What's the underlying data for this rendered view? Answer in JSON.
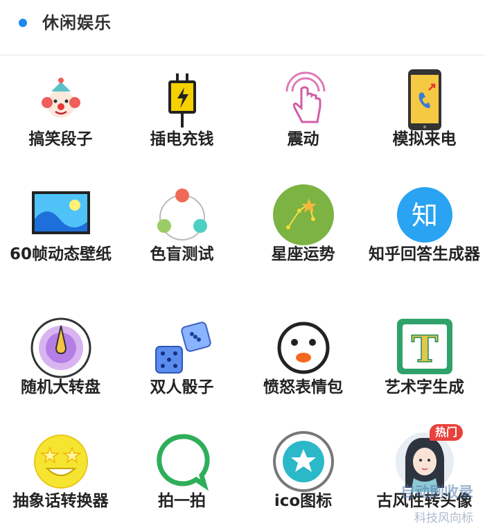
{
  "section": {
    "title": "休闲娱乐"
  },
  "tiles": [
    {
      "label": "搞笑段子",
      "icon": "clown-icon"
    },
    {
      "label": "插电充钱",
      "icon": "plug-icon"
    },
    {
      "label": "震动",
      "icon": "finger-tap-icon"
    },
    {
      "label": "模拟来电",
      "icon": "phone-call-icon"
    },
    {
      "label": "60帧动态壁纸",
      "icon": "wallpaper-icon"
    },
    {
      "label": "色盲测试",
      "icon": "color-test-icon"
    },
    {
      "label": "星座运势",
      "icon": "constellation-icon"
    },
    {
      "label": "知乎回答生成器",
      "icon": "zhihu-icon",
      "icon_text": "知"
    },
    {
      "label": "随机大转盘",
      "icon": "spinner-wheel-icon"
    },
    {
      "label": "双人骰子",
      "icon": "dice-icon"
    },
    {
      "label": "愤怒表情包",
      "icon": "angry-face-icon"
    },
    {
      "label": "艺术字生成",
      "icon": "art-text-icon",
      "icon_text": "T"
    },
    {
      "label": "抽象话转换器",
      "icon": "star-eyes-emoji-icon"
    },
    {
      "label": "拍一拍",
      "icon": "chat-bubble-icon"
    },
    {
      "label": "ico图标",
      "icon": "star-badge-icon"
    },
    {
      "label": "古风性转头像",
      "icon": "avatar-icon",
      "badge": "热门"
    }
  ],
  "watermark": {
    "line1": "自动刷收录",
    "line2": "科技风向标"
  },
  "colors": {
    "accent": "#1e88f0",
    "badge": "#e9413b"
  }
}
